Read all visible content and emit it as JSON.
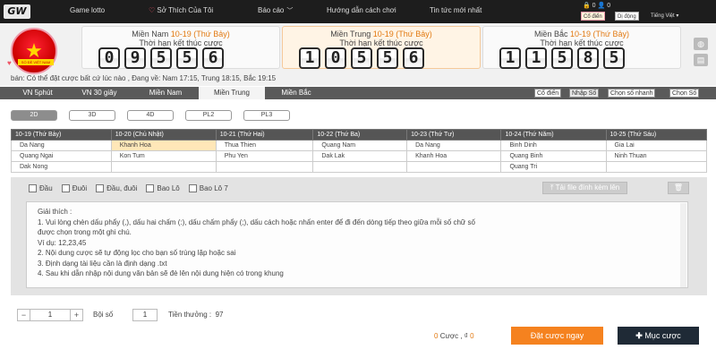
{
  "top_nav": {
    "logo": "GW",
    "items": [
      "Game lotto",
      "Sở Thích Của Tôi",
      "Báo cáo",
      "Hướng dẫn cách chơi",
      "Tin tức mới nhất"
    ],
    "account_line": "0",
    "mode_classic": "Cổ điển",
    "mode_new": "Dị động",
    "language": "Tiếng Việt"
  },
  "header": {
    "avatar_text": "SỔ ĐỀ VIỆT NAM",
    "panels": [
      {
        "region": "Miền Nam",
        "date": "10-19 (Thứ Bảy)",
        "subtitle": "Thời hạn kết thúc cược",
        "digits": [
          "0",
          "9",
          "5",
          "5",
          "6"
        ]
      },
      {
        "region": "Miền Trung",
        "date": "10-19 (Thứ Bảy)",
        "subtitle": "Thời hạn kết thúc cược",
        "digits": [
          "1",
          "0",
          "5",
          "5",
          "6"
        ]
      },
      {
        "region": "Miền Bắc",
        "date": "10-19 (Thứ Bảy)",
        "subtitle": "Thời hạn kết thúc cược",
        "digits": [
          "1",
          "1",
          "5",
          "8",
          "5"
        ]
      }
    ],
    "notice": "bán: Có thể đặt cược bất cứ lúc nào , Đang về: Nam 17:15, Trung 18:15, Bắc 19:15"
  },
  "main_tabs": [
    "VN 5phút",
    "VN 30 giây",
    "Miền Nam",
    "Miền Trung",
    "Miền Bắc"
  ],
  "active_main_tab": "Miền Trung",
  "view_tabs": [
    "Cổ điển",
    "Nhập Số",
    "Chọn số nhanh",
    "Chọn Số"
  ],
  "active_view_tab": "Nhập Số",
  "sub_tabs": [
    "2D",
    "3D",
    "4D",
    "PL2",
    "PL3"
  ],
  "active_sub_tab": "2D",
  "schedule": {
    "headers": [
      "10-19 (Thứ Bảy)",
      "10-20 (Chủ Nhật)",
      "10-21 (Thứ Hai)",
      "10-22 (Thứ Ba)",
      "10-23 (Thứ Tư)",
      "10-24 (Thứ Năm)",
      "10-25 (Thứ Sáu)"
    ],
    "rows": [
      [
        "Da Nang",
        "Khanh Hoa",
        "Thua Thien",
        "Quang Nam",
        "Da Nang",
        "Binh Dinh",
        "Gia Lai"
      ],
      [
        "Quang Ngai",
        "Kon Tum",
        "Phu Yen",
        "Dak Lak",
        "Khanh Hoa",
        "Quang Binh",
        "Ninh Thuan"
      ],
      [
        "Dak Nong",
        "",
        "",
        "",
        "",
        "Quang Tri",
        ""
      ]
    ]
  },
  "input_area": {
    "checkboxes": [
      "Đầu",
      "Đuôi",
      "Đầu, đuôi",
      "Bao Lô",
      "Bao Lô 7"
    ],
    "upload_label": "Tải file đính kèm lên",
    "instructions": [
      "Giải thích :",
      "1. Vui lòng chèn dấu phẩy (,), dấu hai chấm (:), dấu chấm phẩy (;), dấu cách hoặc nhấn enter để đi đến dòng tiếp theo giữa mỗi số chữ số",
      "được chọn trong một ghi chú.",
      "Ví dụ: 12,23,45",
      "2. Nội dung cược sẽ tự động lọc cho bạn số trùng lặp hoặc sai",
      "3. Định dạng tài liệu cần là định dạng .txt",
      "4. Sau khi dẫn nhập nội dung văn bản sẽ đè lên nội dung hiện có trong khung"
    ]
  },
  "bet_controls": {
    "quantity": "1",
    "multiplier_label": "Bội số",
    "multiplier": "1",
    "prize_label": "Tiền thưởng :",
    "prize_value": "97",
    "count_value": "0",
    "count_label": "Cược ,",
    "amount_label": "₫",
    "amount_value": "0",
    "place_bet": "Đặt cược ngay",
    "add_item": "Mục cược"
  }
}
